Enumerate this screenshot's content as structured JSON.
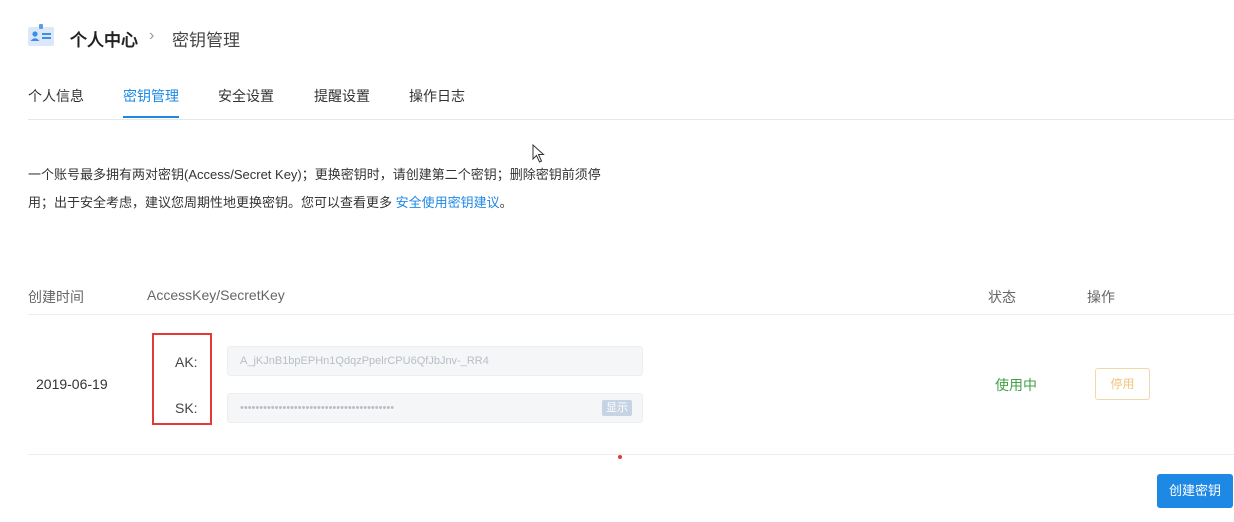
{
  "header": {
    "title": "个人中心",
    "separator": "›",
    "subtitle": "密钥管理",
    "icon": "profile-card-icon"
  },
  "tabs": [
    {
      "label": "个人信息",
      "active": false
    },
    {
      "label": "密钥管理",
      "active": true
    },
    {
      "label": "安全设置",
      "active": false
    },
    {
      "label": "提醒设置",
      "active": false
    },
    {
      "label": "操作日志",
      "active": false
    }
  ],
  "description": {
    "line1": "一个账号最多拥有两对密钥(Access/Secret Key)；更换密钥时，请创建第二个密钥；删除密钥前须停",
    "line2": "用；出于安全考虑，建议您周期性地更换密钥。您可以查看更多 ",
    "link": "安全使用密钥建议",
    "line2_end": "。"
  },
  "table": {
    "headers": {
      "created": "创建时间",
      "keys": "AccessKey/SecretKey",
      "status": "状态",
      "actions": "操作"
    },
    "rows": [
      {
        "created": "2019-06-19",
        "ak_label": "AK:",
        "ak_value": "A_jKJnB1bpEPHn1QdqzPpelrCPU6QfJbJnv-_RR4",
        "sk_label": "SK:",
        "sk_value": "••••••••••••••••••••••••••••••••••••••••",
        "show_label": "显示",
        "status": "使用中",
        "disable_label": "停用"
      }
    ]
  },
  "create_button": "创建密钥",
  "colors": {
    "accent": "#1e88e5",
    "status_active": "#43a047",
    "highlight": "#e53935",
    "disable_border": "#f0d8a8"
  }
}
